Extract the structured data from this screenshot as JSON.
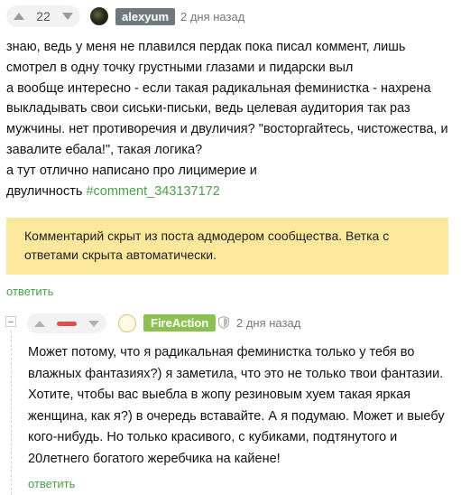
{
  "comment1": {
    "score": "22",
    "author": "alexyum",
    "time": "2 дня назад",
    "lines": [
      "знаю, ведь у меня не плавился пердак пока писал коммент, лишь",
      "смотрел в одну точку грустными глазами и пидарски выл",
      "а вообще интересно - если такая радикальная феминистка - нахрена",
      "выкладывать свои сиськи-письки, ведь целевая аудитория так раз",
      "мужчины. нет противоречия и двуличия? \"восторгайтесь, чистожества, и",
      "завалите ебала!\", такая логика?",
      "а тут отлично написано про лицимерие и"
    ],
    "last_line_prefix": "двуличность ",
    "tag": "#comment_343137172",
    "hidden_notice": "Комментарий скрыт из поста адмодером сообщества. Ветка с ответами скрыта автоматически.",
    "reply_label": "ответить"
  },
  "comment2": {
    "author": "FireAction",
    "time": "2 дня назад",
    "lines": [
      "Может потому, что я радикальная феминистка только у тебя во",
      "влажных фантазиях?) я заметила, что это не только твои фантазии.",
      "Хотите, чтобы вас выебла в жопу резиновым хуем такая яркая",
      "женщина, как я?) в очередь вставайте. А я подумаю. Может и выебу",
      "кого-нибудь. Но только красивого, с кубиками, подтянутого и",
      "20летнего богатого жеребчика на кайене!"
    ],
    "reply_label": "ответить"
  },
  "colors": {
    "accent_green": "#4aa14a",
    "notice_bg": "#fbe89c",
    "negative": "#d9534f",
    "author2_bg": "#8cc152",
    "author1_bg": "#6e7a80"
  }
}
